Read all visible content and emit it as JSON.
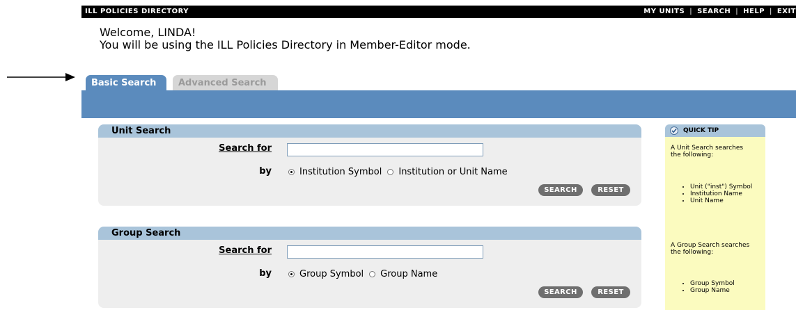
{
  "header": {
    "app_title": "ILL POLICIES DIRECTORY",
    "nav": [
      "MY UNITS",
      "SEARCH",
      "HELP",
      "EXIT"
    ]
  },
  "welcome": {
    "greeting": "Welcome, LINDA!",
    "mode_message": "You will be using the ILL Policies Directory in Member-Editor mode."
  },
  "tabs": [
    {
      "label": "Basic Search",
      "active": true
    },
    {
      "label": "Advanced Search",
      "active": false
    }
  ],
  "unit_search": {
    "title": "Unit Search",
    "search_for_label": "Search for",
    "search_value": "",
    "by_label": "by",
    "options": [
      "Institution Symbol",
      "Institution or Unit Name"
    ],
    "selected": "Institution Symbol",
    "search_button": "SEARCH",
    "reset_button": "RESET"
  },
  "group_search": {
    "title": "Group Search",
    "search_for_label": "Search for",
    "search_value": "",
    "by_label": "by",
    "options": [
      "Group Symbol",
      "Group Name"
    ],
    "selected": "Group Symbol",
    "search_button": "SEARCH",
    "reset_button": "RESET"
  },
  "quick_tip": {
    "title": "QUICK TIP",
    "icon": "check-icon",
    "unit_intro": "A Unit Search searches the following:",
    "unit_items": [
      "Unit (\"inst\") Symbol",
      "Institution Name",
      "Unit Name"
    ],
    "group_intro": "A Group Search searches the following:",
    "group_items": [
      "Group Symbol",
      "Group Name"
    ]
  },
  "colors": {
    "tab_bar": "#5b8bbd",
    "panel_header": "#a9c4da",
    "panel_body": "#eeeeee",
    "tip_body": "#fbfbbf",
    "button": "#6f6f6f"
  }
}
